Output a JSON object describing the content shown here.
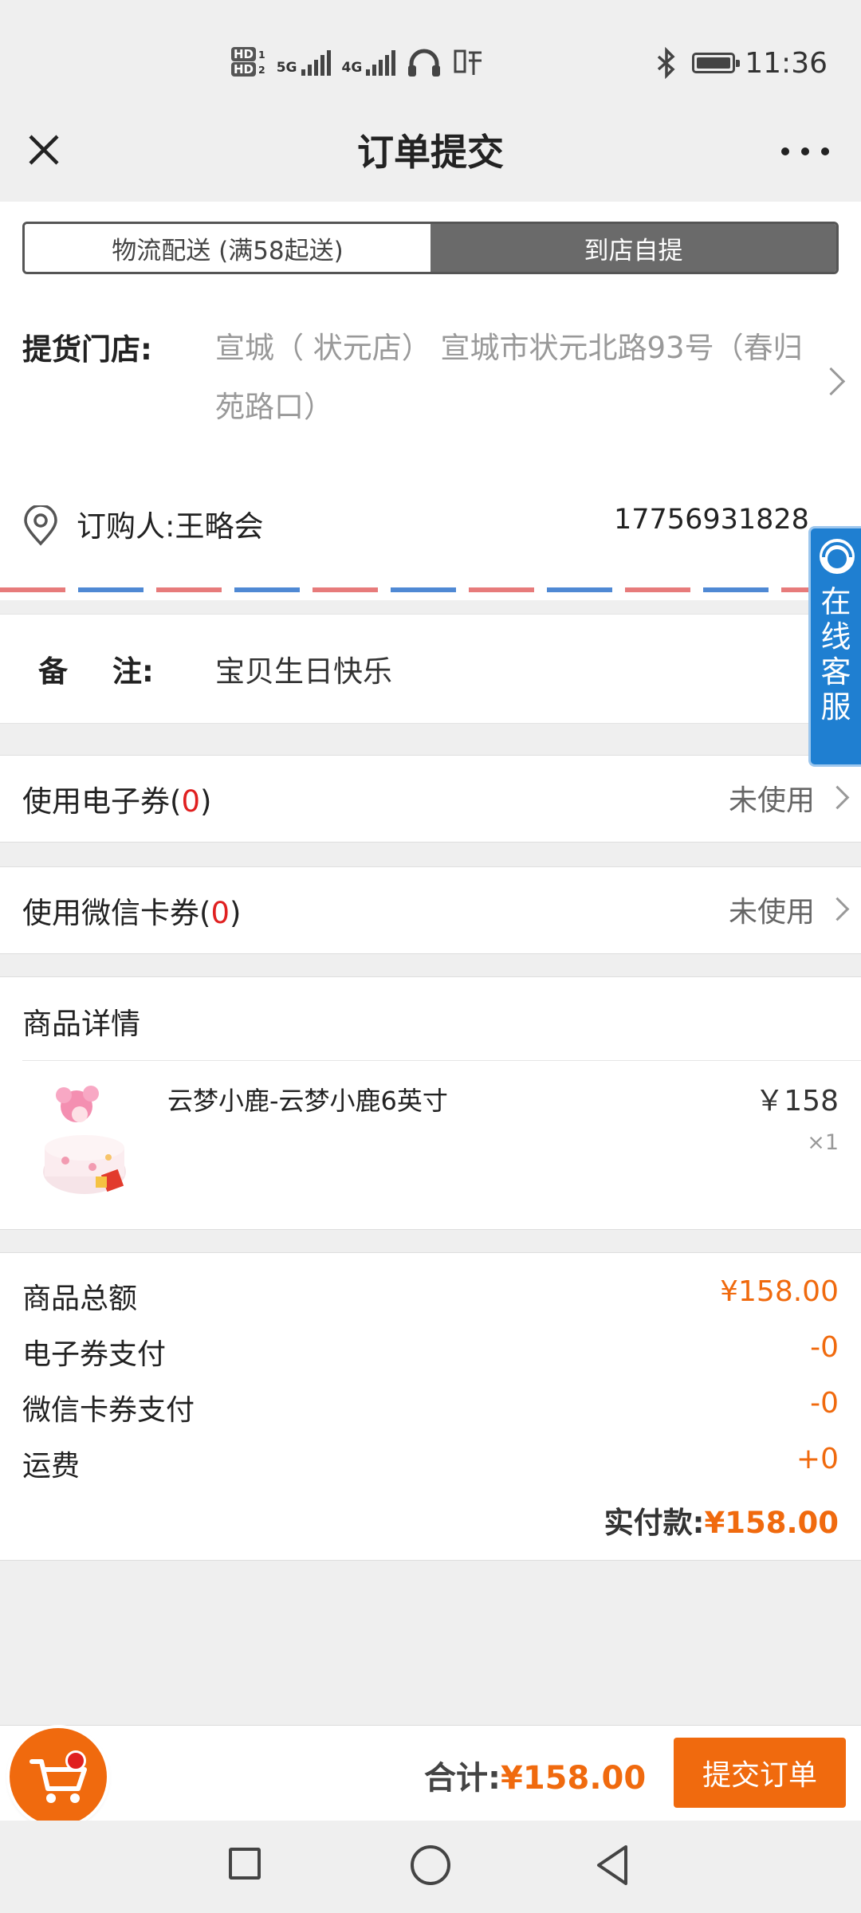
{
  "status_bar": {
    "hd1": "HD",
    "hd1_sub": "1",
    "hd2": "HD",
    "hd2_sub": "2",
    "net1": "5G",
    "net2": "4G",
    "time": "11:36"
  },
  "header": {
    "title": "订单提交"
  },
  "delivery_tabs": [
    {
      "label": "物流配送 (满58起送)",
      "selected": false
    },
    {
      "label": "到店自提",
      "selected": true
    }
  ],
  "store": {
    "label": "提货门店:",
    "address": "宣城（ 状元店） 宣城市状元北路93号（春归苑路口）"
  },
  "buyer": {
    "label": "订购人:王略会",
    "phone": "17756931828"
  },
  "note": {
    "label_a": "备",
    "label_b": "注:",
    "text": "宝贝生日快乐"
  },
  "coupons": [
    {
      "label": "使用电子券(",
      "count": "0",
      "close": ")",
      "status": "未使用"
    },
    {
      "label": "使用微信卡券(",
      "count": "0",
      "close": ")",
      "status": "未使用"
    }
  ],
  "goods": {
    "heading": "商品详情",
    "item": {
      "name": "云梦小鹿-云梦小鹿6英寸",
      "price": "￥158",
      "qty_x": "×",
      "qty": "1"
    }
  },
  "summary": {
    "rows": [
      {
        "label": "商品总额",
        "value": "¥158.00"
      },
      {
        "label": "电子券支付",
        "value": "-0"
      },
      {
        "label": "微信卡券支付",
        "value": "-0"
      },
      {
        "label": "运费",
        "value": "+0"
      }
    ],
    "paid_label": "实付款:",
    "paid_value": "¥158.00"
  },
  "service": {
    "label": "在线客服"
  },
  "bottom": {
    "total_label": "合计:",
    "total_value": "¥158.00",
    "submit_label": "提交订单"
  },
  "colors": {
    "accent": "#f06a0e",
    "red": "#e02020",
    "service_blue": "#1f7fd1"
  }
}
